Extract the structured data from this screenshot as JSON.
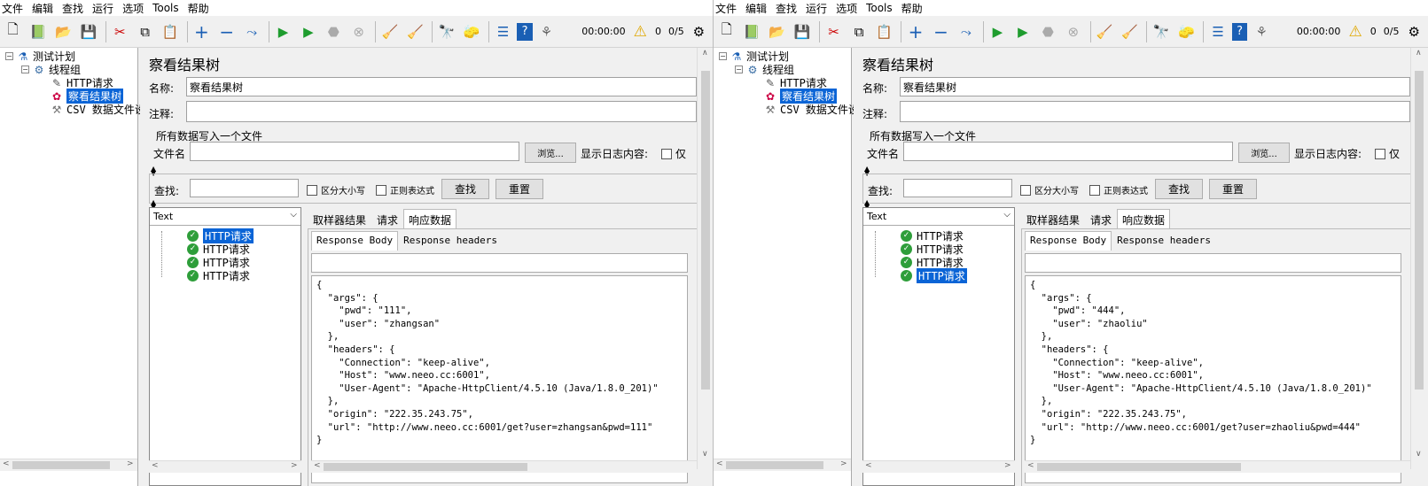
{
  "menu": [
    "文件",
    "编辑",
    "查找",
    "运行",
    "选项",
    "Tools",
    "帮助"
  ],
  "toolbar": {
    "timer": "00:00:00",
    "warn_count": "0",
    "threads": "0/5"
  },
  "colors": {
    "selection": "#0a64d6",
    "ok": "#2e9e3a",
    "panel": "#f0f0f0"
  },
  "tree": {
    "plan": "测试计划",
    "group": "线程组",
    "http": "HTTP请求",
    "listener": "察看结果树",
    "csv": "CSV 数据文件设"
  },
  "panel": {
    "title": "察看结果树",
    "name_label": "名称:",
    "name_value": "察看结果树",
    "comment_label": "注释:",
    "file_section": "所有数据写入一个文件",
    "file_label": "文件名",
    "browse": "浏览...",
    "log_label": "显示日志内容:",
    "log_opt": "仅",
    "find_label": "查找:",
    "case": "区分大小写",
    "regex": "正则表达式",
    "find_btn": "查找",
    "reset_btn": "重置",
    "renderer": "Text",
    "tabs": [
      "取样器结果",
      "请求",
      "响应数据"
    ],
    "subtabs": [
      "Response Body",
      "Response headers"
    ]
  },
  "windows": [
    {
      "results": [
        "HTTP请求",
        "HTTP请求",
        "HTTP请求",
        "HTTP请求"
      ],
      "selected_result": 0,
      "response": "{\n  \"args\": {\n    \"pwd\": \"111\",\n    \"user\": \"zhangsan\"\n  },\n  \"headers\": {\n    \"Connection\": \"keep-alive\",\n    \"Host\": \"www.neeo.cc:6001\",\n    \"User-Agent\": \"Apache-HttpClient/4.5.10 (Java/1.8.0_201)\"\n  },\n  \"origin\": \"222.35.243.75\",\n  \"url\": \"http://www.neeo.cc:6001/get?user=zhangsan&pwd=111\"\n}"
    },
    {
      "results": [
        "HTTP请求",
        "HTTP请求",
        "HTTP请求",
        "HTTP请求"
      ],
      "selected_result": 3,
      "response": "{\n  \"args\": {\n    \"pwd\": \"444\",\n    \"user\": \"zhaoliu\"\n  },\n  \"headers\": {\n    \"Connection\": \"keep-alive\",\n    \"Host\": \"www.neeo.cc:6001\",\n    \"User-Agent\": \"Apache-HttpClient/4.5.10 (Java/1.8.0_201)\"\n  },\n  \"origin\": \"222.35.243.75\",\n  \"url\": \"http://www.neeo.cc:6001/get?user=zhaoliu&pwd=444\"\n}"
    }
  ]
}
